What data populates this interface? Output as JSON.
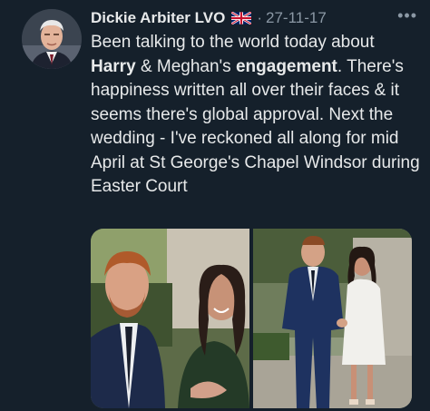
{
  "tweet": {
    "author_name": "Dickie Arbiter LVO",
    "flag_icon": "uk-flag-icon",
    "date": "27-11-17",
    "more_icon": "more-options-icon",
    "text": {
      "p1": "Been talking to the world today about",
      "b1": "Harry",
      "p2": "& Meghan's",
      "b2": "engagement",
      "p3": ". There's happiness written all over their faces & it seems there's global approval. Next the wedding - I've reckoned all along for mid April at St George's Chapel Windsor during Easter Court"
    },
    "media": {
      "photo_count": 2
    }
  },
  "colors": {
    "background": "#15202b",
    "text": "#e7e9ea",
    "muted": "#8b98a5"
  }
}
